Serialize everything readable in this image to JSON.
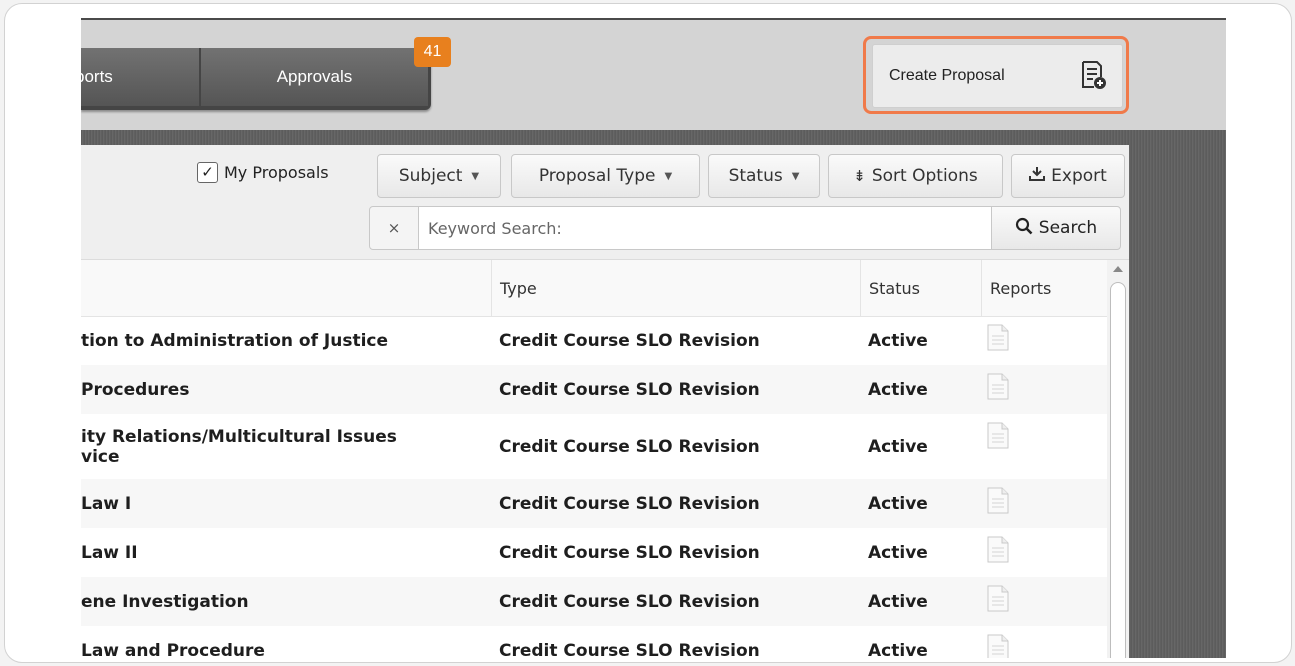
{
  "nav": {
    "reports_label": "Reports",
    "reports_visible": "ports",
    "approvals_label": "Approvals",
    "approvals_badge": "41"
  },
  "create_proposal": {
    "label": "Create Proposal",
    "icon": "document-add-icon"
  },
  "filters": {
    "my_proposals_label": "My Proposals",
    "my_proposals_checked": true,
    "subject_label": "Subject",
    "proposal_type_label": "Proposal Type",
    "status_label": "Status",
    "sort_label": "Sort Options",
    "export_label": "Export"
  },
  "search": {
    "clear_label": "×",
    "placeholder": "Keyword Search:",
    "button_label": "Search"
  },
  "table": {
    "columns": {
      "type": "Type",
      "status": "Status",
      "reports": "Reports"
    },
    "rows": [
      {
        "title": "tion to Administration of Justice",
        "type": "Credit Course SLO Revision",
        "status": "Active"
      },
      {
        "title": "Procedures",
        "type": "Credit Course SLO Revision",
        "status": "Active"
      },
      {
        "title_line1": "ity Relations/Multicultural Issues",
        "title_line2": "vice",
        "type": "Credit Course SLO Revision",
        "status": "Active"
      },
      {
        "title": "Law I",
        "type": "Credit Course SLO Revision",
        "status": "Active"
      },
      {
        "title": "Law II",
        "type": "Credit Course SLO Revision",
        "status": "Active"
      },
      {
        "title": "ene Investigation",
        "type": "Credit Course SLO Revision",
        "status": "Active"
      },
      {
        "title": "Law and Procedure",
        "type": "Credit Course SLO Revision",
        "status": "Active"
      }
    ]
  },
  "colors": {
    "accent_orange": "#e8801e",
    "highlight_border": "#f07a4a",
    "nav_dark": "#555555"
  }
}
